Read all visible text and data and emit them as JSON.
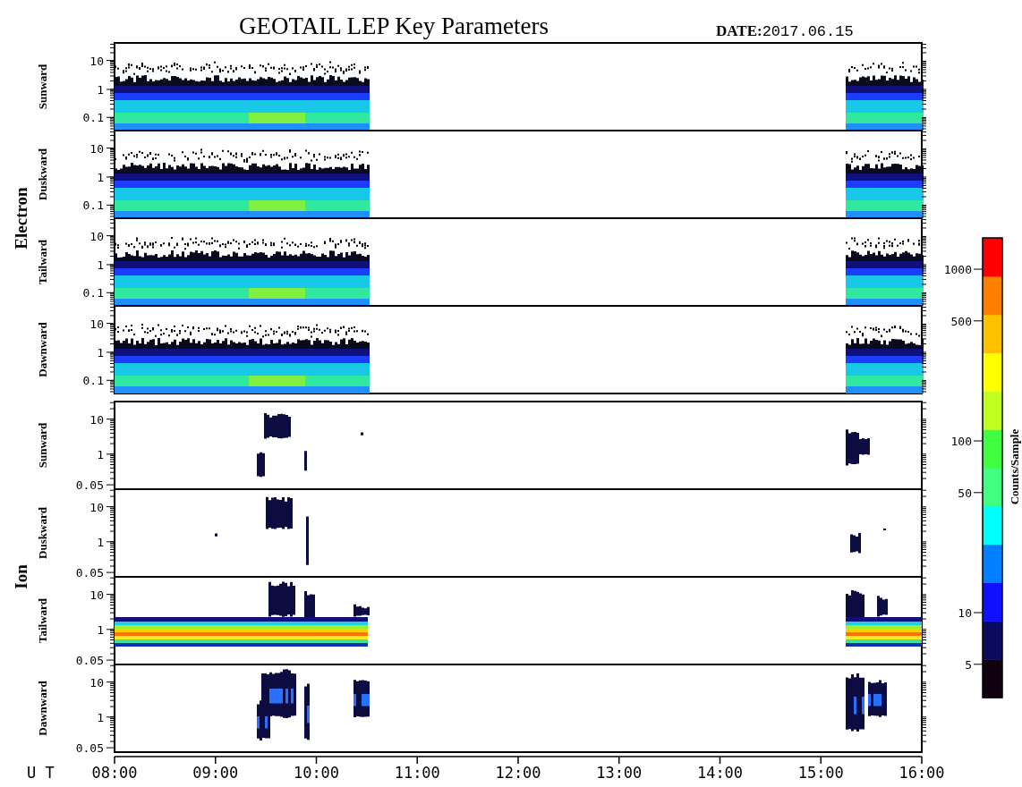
{
  "title": "GEOTAIL LEP Key Parameters",
  "date_label": "DATE:",
  "date": "2017.06.15",
  "groups": [
    {
      "label": "Electron",
      "kind": "electron",
      "panels": [
        {
          "label": "Sunward",
          "yticks": [
            "10",
            "1",
            "0.1"
          ]
        },
        {
          "label": "Duskward",
          "yticks": [
            "10",
            "1",
            "0.1"
          ]
        },
        {
          "label": "Tailward",
          "yticks": [
            "10",
            "1",
            "0.1"
          ]
        },
        {
          "label": "Dawnward",
          "yticks": [
            "10",
            "1",
            "0.1"
          ]
        }
      ]
    },
    {
      "label": "Ion",
      "kind": "ion",
      "panels": [
        {
          "label": "Sunward",
          "yticks": [
            "10",
            "1",
            "0.05"
          ]
        },
        {
          "label": "Duskward",
          "yticks": [
            "10",
            "1",
            "0.05"
          ]
        },
        {
          "label": "Tailward",
          "yticks": [
            "10",
            "1",
            "0.05"
          ]
        },
        {
          "label": "Dawnward",
          "yticks": [
            "10",
            "1",
            "0.05"
          ]
        }
      ]
    }
  ],
  "time_axis": {
    "label": "U T",
    "ticks": [
      "08:00",
      "09:00",
      "10:00",
      "11:00",
      "12:00",
      "13:00",
      "14:00",
      "15:00",
      "16:00"
    ]
  },
  "colorbar": {
    "label": "Counts/Sample",
    "ticks": [
      "1000",
      "500",
      "100",
      "50",
      "10",
      "5"
    ]
  }
}
